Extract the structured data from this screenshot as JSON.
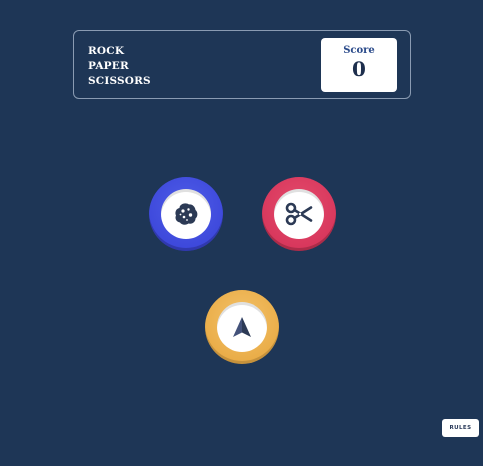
{
  "header": {
    "title_lines": [
      "ROCK",
      "PAPER",
      "SCISSORS"
    ],
    "score_label": "Score",
    "score_value": "0"
  },
  "choices": [
    {
      "id": "rock",
      "icon": "rock-icon",
      "color": "#3f4ee0"
    },
    {
      "id": "scissors",
      "icon": "scissors-icon",
      "color": "#d9375e"
    },
    {
      "id": "paper",
      "icon": "paper-icon",
      "color": "#eab04f"
    }
  ],
  "footer": {
    "rules_label": "RULES"
  },
  "colors": {
    "background": "#1e3656",
    "header_border": "#8a9bb2",
    "icon_color": "#2c3a55"
  }
}
